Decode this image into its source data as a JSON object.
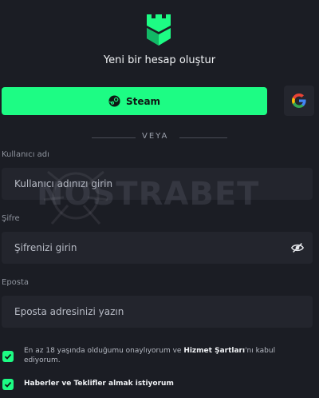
{
  "header": {
    "logo_icon": "castle-shield-icon",
    "title": "Yeni bir hesap oluştur"
  },
  "auth": {
    "steam_label": "Steam",
    "steam_icon": "steam-icon",
    "google_icon": "google-icon"
  },
  "divider": {
    "text": "VEYA"
  },
  "form": {
    "username": {
      "label": "Kullanıcı adı",
      "placeholder": "Kullanıcı adınızı girin"
    },
    "password": {
      "label": "Şifre",
      "placeholder": "Şifrenizi girin",
      "toggle_icon": "eye-slash-icon"
    },
    "email": {
      "label": "Eposta",
      "placeholder": "Eposta adresinizi yazın"
    }
  },
  "terms": {
    "checked": true,
    "text_before": "En az 18 yaşında olduğumu onaylıyorum ve ",
    "link": "Hizmet Şartları",
    "text_after": "'nı kabul ediyorum."
  },
  "newsletter": {
    "checked": true,
    "label": "Haberler ve Teklifler almak istiyorum"
  },
  "watermark": "NOSTRABET",
  "colors": {
    "accent": "#1dfc84",
    "background": "#1b1d24",
    "field": "#23252d"
  }
}
